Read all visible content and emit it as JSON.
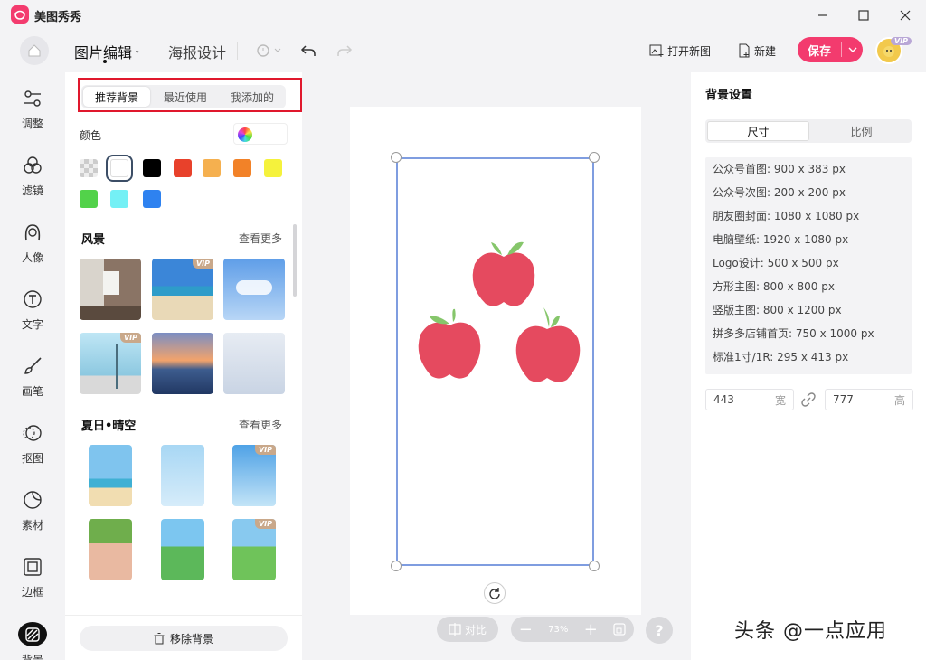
{
  "app": {
    "title": "美图秀秀"
  },
  "toolbar": {
    "tab_edit": "图片编辑",
    "tab_poster": "海报设计",
    "open_new": "打开新图",
    "new": "新建",
    "save": "保存",
    "vip": "VIP"
  },
  "rail": [
    {
      "label": "调整"
    },
    {
      "label": "滤镜"
    },
    {
      "label": "人像"
    },
    {
      "label": "文字"
    },
    {
      "label": "画笔"
    },
    {
      "label": "抠图"
    },
    {
      "label": "素材"
    },
    {
      "label": "边框"
    },
    {
      "label": "背景"
    }
  ],
  "panel": {
    "tabs": [
      "推荐背景",
      "最近使用",
      "我添加的"
    ],
    "color_label": "颜色",
    "swatches": [
      "transparent",
      "#ffffff",
      "#000000",
      "#e8412b",
      "#f5b04f",
      "#f28228",
      "#f5f23c",
      "#52d24a",
      "#74f0f5",
      "#2e82f0"
    ],
    "section1": {
      "title": "风景",
      "more": "查看更多"
    },
    "section2": {
      "title": "夏日•晴空",
      "more": "查看更多"
    },
    "vip_badge": "VIP",
    "remove_bg": "移除背景"
  },
  "bottom": {
    "compare": "对比",
    "zoom": "73%",
    "help": "?"
  },
  "right": {
    "title": "背景设置",
    "tabs": [
      "尺寸",
      "比例"
    ],
    "presets": [
      "公众号首图: 900 x 383 px",
      "公众号次图: 200 x 200 px",
      "朋友圈封面: 1080 x 1080 px",
      "电脑壁纸: 1920 x 1080 px",
      "Logo设计: 500 x 500 px",
      "方形主图: 800 x 800 px",
      "竖版主图: 800 x 1200 px",
      "拼多多店铺首页: 750 x 1000 px",
      "标准1寸/1R: 295 x 413 px"
    ],
    "width": "443",
    "width_unit": "宽",
    "height": "777",
    "height_unit": "高"
  },
  "watermark": "头条 @一点应用"
}
